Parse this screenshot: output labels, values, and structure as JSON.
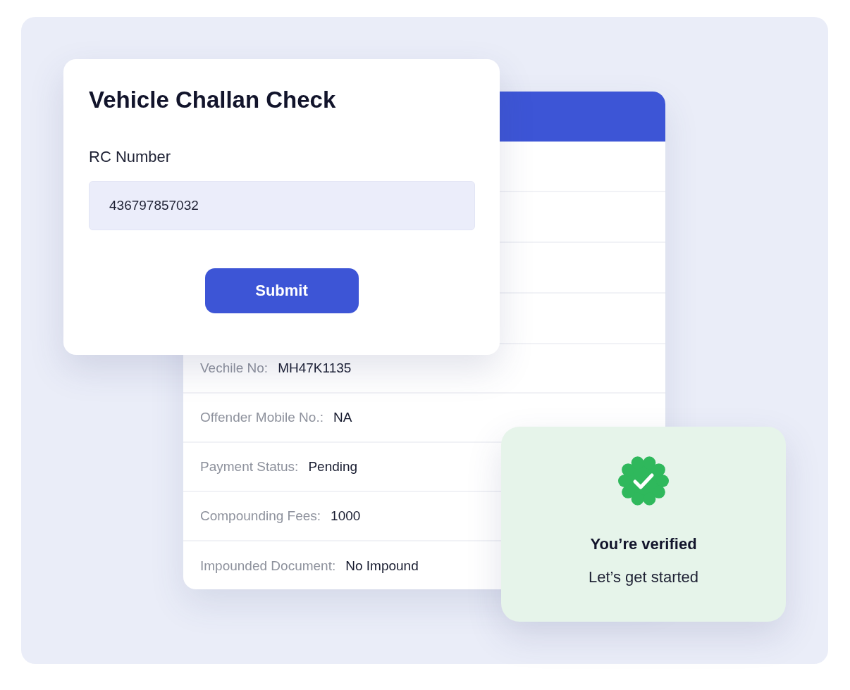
{
  "form": {
    "title": "Vehicle Challan Check",
    "field_label": "RC Number",
    "field_value": "436797857032",
    "submit": "Submit"
  },
  "details": {
    "rows": [
      {
        "label": "Vechile No:",
        "value": "MH47K1135"
      },
      {
        "label": "Offender Mobile No.:",
        "value": "NA"
      },
      {
        "label": "Payment Status:",
        "value": "Pending"
      },
      {
        "label": "Compounding Fees:",
        "value": "1000"
      },
      {
        "label": "Impounded Document:",
        "value": "No Impound"
      }
    ]
  },
  "verified": {
    "title": "You’re verified",
    "subtitle": "Let’s get started"
  }
}
